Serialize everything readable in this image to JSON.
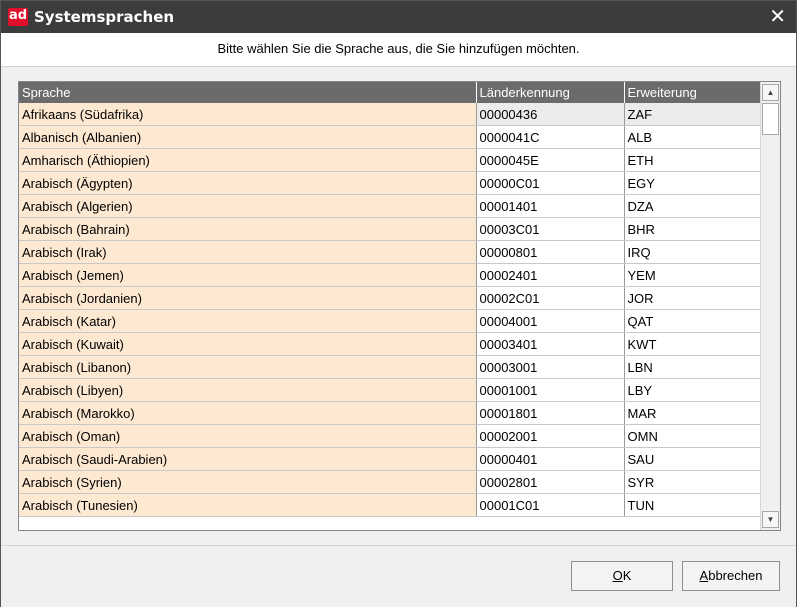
{
  "window": {
    "logo": "ad",
    "title": "Systemsprachen",
    "close_glyph": "✕"
  },
  "instruction": "Bitte wählen Sie die Sprache aus, die Sie hinzufügen möchten.",
  "table": {
    "columns": [
      "Sprache",
      "Länderkennung",
      "Erweiterung"
    ],
    "rows": [
      [
        "Afrikaans (Südafrika)",
        "00000436",
        "ZAF"
      ],
      [
        "Albanisch (Albanien)",
        "0000041C",
        "ALB"
      ],
      [
        "Amharisch (Äthiopien)",
        "0000045E",
        "ETH"
      ],
      [
        "Arabisch (Ägypten)",
        "00000C01",
        "EGY"
      ],
      [
        "Arabisch (Algerien)",
        "00001401",
        "DZA"
      ],
      [
        "Arabisch (Bahrain)",
        "00003C01",
        "BHR"
      ],
      [
        "Arabisch (Irak)",
        "00000801",
        "IRQ"
      ],
      [
        "Arabisch (Jemen)",
        "00002401",
        "YEM"
      ],
      [
        "Arabisch (Jordanien)",
        "00002C01",
        "JOR"
      ],
      [
        "Arabisch (Katar)",
        "00004001",
        "QAT"
      ],
      [
        "Arabisch (Kuwait)",
        "00003401",
        "KWT"
      ],
      [
        "Arabisch (Libanon)",
        "00003001",
        "LBN"
      ],
      [
        "Arabisch (Libyen)",
        "00001001",
        "LBY"
      ],
      [
        "Arabisch (Marokko)",
        "00001801",
        "MAR"
      ],
      [
        "Arabisch (Oman)",
        "00002001",
        "OMN"
      ],
      [
        "Arabisch (Saudi-Arabien)",
        "00000401",
        "SAU"
      ],
      [
        "Arabisch (Syrien)",
        "00002801",
        "SYR"
      ],
      [
        "Arabisch (Tunesien)",
        "00001C01",
        "TUN"
      ]
    ],
    "selected_row": 0
  },
  "scrollbar": {
    "up_icon": "scroll-up-arrow",
    "down_icon": "scroll-down-arrow"
  },
  "buttons": {
    "ok_accel": "O",
    "ok_rest": "K",
    "cancel_accel": "A",
    "cancel_rest": "bbrechen"
  },
  "colors": {
    "titlebar": "#3c3c3c",
    "logo": "#e0102a",
    "header_row": "#6b6b6b",
    "language_column": "#fde9d2"
  }
}
